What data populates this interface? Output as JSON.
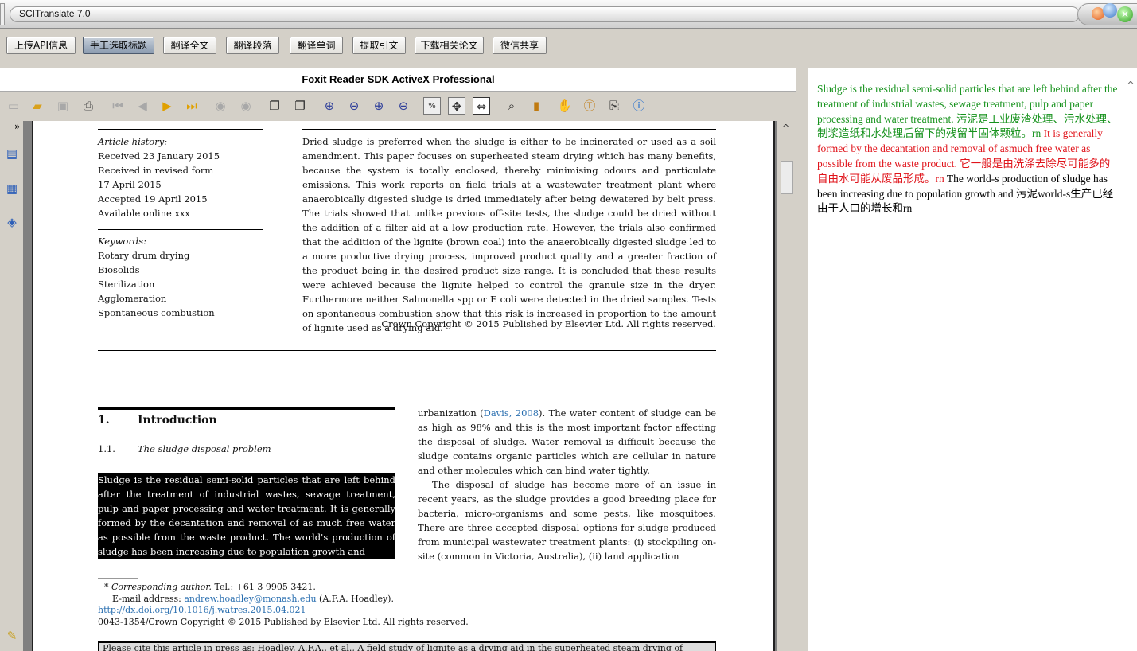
{
  "app": {
    "title": "SCITranslate 7.0"
  },
  "toolbar": [
    "上传API信息",
    "手工选取标题",
    "翻译全文",
    "翻译段落",
    "翻译单词",
    "提取引文",
    "下载相关论文",
    "微信共享"
  ],
  "reader": {
    "title": "Foxit Reader SDK ActiveX Professional",
    "icons": [
      "open-icon",
      "open-folder-icon",
      "save-icon",
      "print-icon",
      "first-page-icon",
      "prev-page-icon",
      "next-page-icon",
      "last-page-icon",
      "back-icon",
      "forward-icon",
      "actual-size-icon",
      "fit-page-icon",
      "zoom-in-icon",
      "zoom-out-icon",
      "zoom-plus-icon",
      "zoom-minus-icon",
      "percent-icon",
      "fit-width-icon",
      "fit-visible-icon",
      "find-icon",
      "bookmark-icon",
      "hand-tool-icon",
      "text-tool-icon",
      "snapshot-icon",
      "info-icon"
    ],
    "side_icons": [
      "pages-icon",
      "thumbnails-icon",
      "layers-icon",
      "attachments-icon"
    ]
  },
  "page": {
    "history_head": "Article history:",
    "history": [
      "Received 23 January 2015",
      "Received in revised form",
      "17 April 2015",
      "Accepted 19 April 2015",
      "Available online xxx"
    ],
    "keywords_head": "Keywords:",
    "keywords": [
      "Rotary drum drying",
      "Biosolids",
      "Sterilization",
      "Agglomeration",
      "Spontaneous combustion"
    ],
    "abstract": "Dried sludge is preferred when the sludge is either to be incinerated or used as a soil amendment. This paper focuses on superheated steam drying which has many benefits, because the system is totally enclosed, thereby minimising odours and particulate emissions. This work reports on field trials at a wastewater treatment plant where anaerobically digested sludge is dried immediately after being dewatered by belt press. The trials showed that unlike previous off-site tests, the sludge could be dried without the addition of a filter aid at a low production rate. However, the trials also confirmed that the addition of the lignite (brown coal) into the anaerobically digested sludge led to a more productive drying process, improved product quality and a greater fraction of the product being in the desired product size range. It is concluded that these results were achieved because the lignite helped to control the granule size in the dryer. Furthermore neither Salmonella spp or E coli were detected in the dried samples. Tests on spontaneous combustion show that this risk is increased in proportion to the amount of lignite used as a drying aid.",
    "copyright": "Crown Copyright © 2015 Published by Elsevier Ltd. All rights reserved.",
    "sec_num": "1.",
    "sec_title": "Introduction",
    "sub_num": "1.1.",
    "sub_title": "The sludge disposal problem",
    "highlight": "Sludge is the residual semi-solid particles that are left behind after the treatment of industrial wastes, sewage treatment, pulp and paper processing and water treatment. It is generally formed by the decantation and removal of as much free water as possible from the waste product. The world's production of sludge has been increasing due to population growth and",
    "right_p1a": "urbanization (",
    "right_link": "Davis, 2008",
    "right_p1b": "). The water content of sludge can be as high as 98% and this is the most important factor affecting the disposal of sludge. Water removal is difficult because the sludge contains organic particles which are cellular in nature and other molecules which can bind water tightly.",
    "right_p2": "The disposal of sludge has become more of an issue in recent years, as the sludge provides a good breeding place for bacteria, micro-organisms and some pests, like mosquitoes. There are three accepted disposal options for sludge produced from municipal wastewater treatment plants: (i) stockpiling on-site (common in Victoria, Australia), (ii) land application",
    "fn_star": "* ",
    "fn_corr": "Corresponding author.",
    "fn_tel": " Tel.: +61 3 9905 3421.",
    "fn_email_label": "E-mail address: ",
    "fn_email": "andrew.hoadley@monash.edu",
    "fn_email_name": " (A.F.A. Hoadley).",
    "fn_doi": "http://dx.doi.org/10.1016/j.watres.2015.04.021",
    "fn_issn": "0043-1354/Crown Copyright © 2015 Published by Elsevier Ltd. All rights reserved.",
    "cite": "Please cite this article in press as: Hoadley, A.F.A., et al., A field study of lignite as a drying aid in the superheated steam drying of"
  },
  "translation": {
    "g1": "Sludge is the residual semi-solid particles that are left behind after the treatment of industrial wastes, sewage treatment, pulp and paper processing and water treatment.  污泥是工业废渣处理、污水处理、制浆造纸和水处理后留下的残留半固体颗粒。rn ",
    "r1": "It is generally formed by the decantation and removal of asmuch free water as possible from the waste product.  它一般是由洗涤去除尽可能多的自由水可能从废品形成。rn ",
    "b1": "The world-s production of sludge has been increasing due to population growth and  污泥world-s生产已经由于人口的增长和rn"
  },
  "colors": {
    "green": "#16921c",
    "red": "#e0141b",
    "active_btn": "#8b9bb0"
  }
}
